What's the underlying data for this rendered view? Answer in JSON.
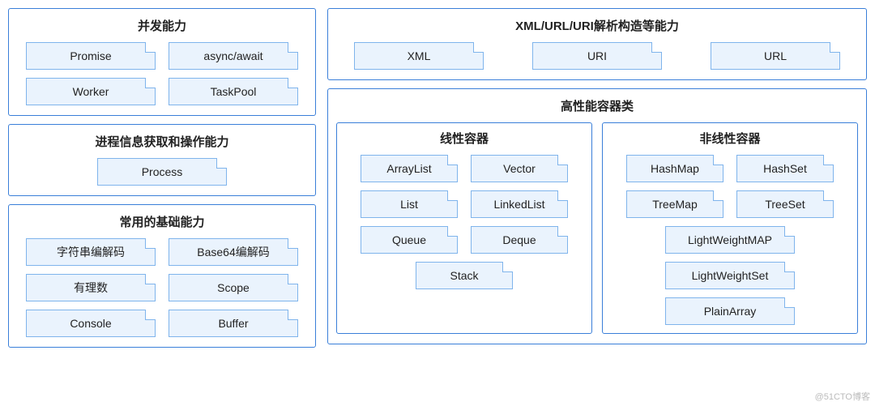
{
  "left": {
    "concurrency": {
      "title": "并发能力",
      "items": [
        "Promise",
        "async/await",
        "Worker",
        "TaskPool"
      ]
    },
    "process": {
      "title": "进程信息获取和操作能力",
      "items": [
        "Process"
      ]
    },
    "basics": {
      "title": "常用的基础能力",
      "items": [
        "字符串编解码",
        "Base64编解码",
        "有理数",
        "Scope",
        "Console",
        "Buffer"
      ]
    }
  },
  "right": {
    "xml": {
      "title": "XML/URL/URI解析构造等能力",
      "items": [
        "XML",
        "URI",
        "URL"
      ]
    },
    "containers": {
      "title": "高性能容器类",
      "linear": {
        "title": "线性容器",
        "items": [
          "ArrayList",
          "Vector",
          "List",
          "LinkedList",
          "Queue",
          "Deque",
          "Stack"
        ]
      },
      "nonlinear": {
        "title": "非线性容器",
        "items": [
          "HashMap",
          "HashSet",
          "TreeMap",
          "TreeSet",
          "LightWeightMAP",
          "LightWeightSet",
          "PlainArray"
        ]
      }
    }
  },
  "watermark": "@51CTO博客"
}
